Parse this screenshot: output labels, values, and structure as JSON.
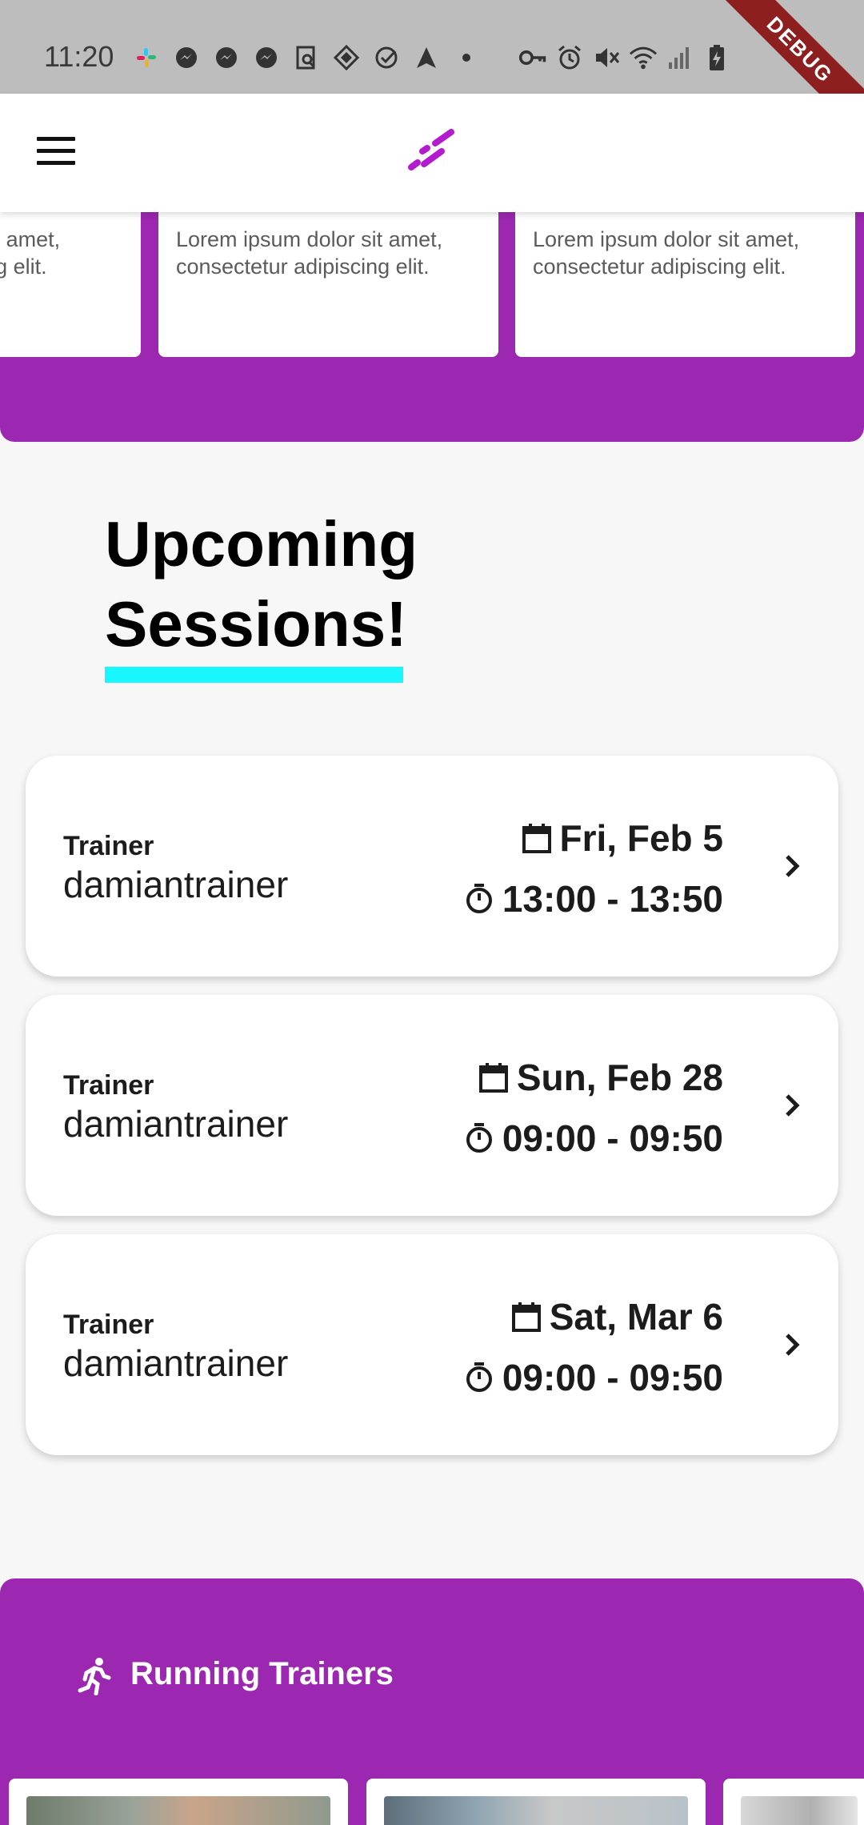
{
  "status_bar": {
    "time": "11:20",
    "debug_label": "DEBUG"
  },
  "app_bar": {
    "menu_icon": "hamburger-menu-icon",
    "logo_icon": "app-logo-icon",
    "logo_color": "#b31bcf"
  },
  "promo_cards": [
    {
      "text": "Lorem ipsum dolor sit amet, consectetur adipiscing elit."
    },
    {
      "text": "Lorem ipsum dolor sit amet, consectetur adipiscing elit."
    },
    {
      "text": "Lorem ipsum dolor sit amet, consectetur adipiscing elit."
    }
  ],
  "upcoming": {
    "title_line1": "Upcoming",
    "title_line2": "Sessions!",
    "underline_color": "#18f7ff"
  },
  "sessions": [
    {
      "trainer_label": "Trainer",
      "trainer_name": "damiantrainer",
      "date": "Fri, Feb 5",
      "time": "13:00 - 13:50"
    },
    {
      "trainer_label": "Trainer",
      "trainer_name": "damiantrainer",
      "date": "Sun, Feb 28",
      "time": "09:00 - 09:50"
    },
    {
      "trainer_label": "Trainer",
      "trainer_name": "damiantrainer",
      "date": "Sat, Mar 6",
      "time": "09:00 - 09:50"
    }
  ],
  "running_trainers": {
    "title": "Running Trainers",
    "icon": "running-person-icon"
  },
  "colors": {
    "purple": "#9c27b0",
    "status_bar": "#bdbdbd",
    "debug_ribbon": "#8e1f1f"
  }
}
